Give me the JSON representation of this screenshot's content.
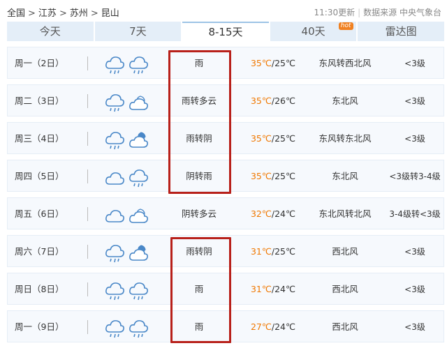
{
  "breadcrumb": [
    "全国",
    "江苏",
    "苏州",
    "昆山"
  ],
  "breadcrumb_sep": ">",
  "update_time": "11:30更新",
  "source": "数据来源 中央气象台",
  "tabs": [
    {
      "label": "今天",
      "active": false
    },
    {
      "label": "7天",
      "active": false
    },
    {
      "label": "8-15天",
      "active": true
    },
    {
      "label": "40天",
      "active": false,
      "badge": "hot"
    },
    {
      "label": "雷达图",
      "active": false
    }
  ],
  "colors": {
    "high_temp": "#f07800",
    "highlight_box": "#b8201a",
    "tab_bg": "#e4eef8"
  },
  "days": [
    {
      "date": "周一（2日）",
      "icons": [
        "rain-cloud-icon",
        "rain-cloud-icon"
      ],
      "desc": "雨",
      "high": "35℃",
      "low": "/25℃",
      "wind": "东风转西北风",
      "level": "<3级"
    },
    {
      "date": "周二（3日）",
      "icons": [
        "rain-cloud-icon",
        "moon-cloud-icon"
      ],
      "desc": "雨转多云",
      "high": "35℃",
      "low": "/26℃",
      "wind": "东北风",
      "level": "<3级"
    },
    {
      "date": "周三（4日）",
      "icons": [
        "rain-cloud-icon",
        "moon-overcast-icon"
      ],
      "desc": "雨转阴",
      "high": "35℃",
      "low": "/25℃",
      "wind": "东风转东北风",
      "level": "<3级"
    },
    {
      "date": "周四（5日）",
      "icons": [
        "cloud-icon",
        "rain-cloud-icon"
      ],
      "desc": "阴转雨",
      "high": "35℃",
      "low": "/25℃",
      "wind": "东北风",
      "level": "<3级转3-4级"
    },
    {
      "date": "周五（6日）",
      "icons": [
        "cloud-icon",
        "moon-cloud-icon"
      ],
      "desc": "阴转多云",
      "high": "32℃",
      "low": "/24℃",
      "wind": "东北风转北风",
      "level": "3-4级转<3级"
    },
    {
      "date": "周六（7日）",
      "icons": [
        "rain-cloud-icon",
        "moon-overcast-icon"
      ],
      "desc": "雨转阴",
      "high": "31℃",
      "low": "/25℃",
      "wind": "西北风",
      "level": "<3级"
    },
    {
      "date": "周日（8日）",
      "icons": [
        "rain-cloud-icon",
        "rain-cloud-icon"
      ],
      "desc": "雨",
      "high": "31℃",
      "low": "/24℃",
      "wind": "西北风",
      "level": "<3级"
    },
    {
      "date": "周一（9日）",
      "icons": [
        "rain-cloud-icon",
        "rain-cloud-icon"
      ],
      "desc": "雨",
      "high": "27℃",
      "low": "/24℃",
      "wind": "西北风",
      "level": "<3级"
    }
  ]
}
